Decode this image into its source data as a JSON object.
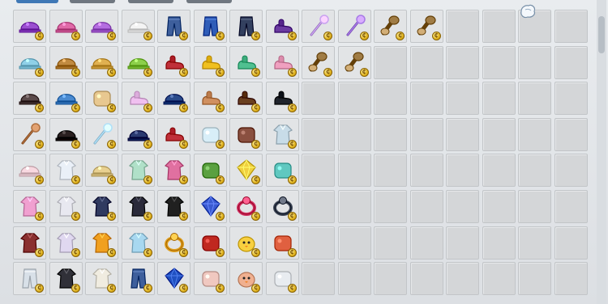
{
  "tabs": [
    {
      "label": "",
      "active": true
    },
    {
      "label": "",
      "active": false
    },
    {
      "label": "",
      "active": false
    },
    {
      "label": "",
      "active": false
    }
  ],
  "coin_label": "₵",
  "grid": {
    "columns": 16,
    "rows": 8,
    "items": [
      [
        "purple-bow-ribbon",
        "pink-headband",
        "purple-bow",
        "white-bonnet",
        "blue-jeans",
        "blue-shorts",
        "navy-pants",
        "purple-boots",
        "crystal-staff",
        "violet-wand",
        "twin-bone-club",
        "twin-bone-club",
        null,
        null,
        null,
        null
      ],
      [
        "bear-hood",
        "straw-hat",
        "ram-horns",
        "sprout-cap",
        "red-sandals",
        "yellow-shoes",
        "green-sneakers",
        "pink-boots",
        "twin-bone-club",
        "twin-bone-club",
        null,
        null,
        null,
        null,
        null,
        null
      ],
      [
        "panda-hood",
        "blue-beanie",
        "pearl-necklace",
        "fairy-wings-shoes",
        "blue-cap",
        "tan-boots",
        "brown-shoes",
        "black-shoes",
        null,
        null,
        null,
        null,
        null,
        null,
        null,
        null
      ],
      [
        "brown-whip",
        "black-hood",
        "ice-feather",
        "blue-hat",
        "red-sandals",
        "white-glove",
        "brown-mitten",
        "white-coat",
        null,
        null,
        null,
        null,
        null,
        null,
        null,
        null
      ],
      [
        "bunny-ears",
        "white-tank-top",
        "shell-hat",
        "mint-robe",
        "pink-flower-dress",
        "green-umbrella",
        "gold-star-pin",
        "teal-scarf",
        null,
        null,
        null,
        null,
        null,
        null,
        null,
        null
      ],
      [
        "pink-dress",
        "white-gown",
        "navy-dress",
        "black-cape",
        "black-robe",
        "star-lantern",
        "red-ring",
        "dark-ring",
        null,
        null,
        null,
        null,
        null,
        null,
        null,
        null
      ],
      [
        "pirate-coat",
        "white-gi",
        "yellow-duck-suit",
        "ghost-costume",
        "gold-ring",
        "red-armor",
        "yellow-chick",
        "candy-box",
        null,
        null,
        null,
        null,
        null,
        null,
        null,
        null
      ],
      [
        "white-overall",
        "black-vest",
        "white-tshirt",
        "blue-jeans",
        "blue-gem",
        "flower-pot",
        "chef-pig",
        "dove-wings",
        null,
        null,
        null,
        null,
        null,
        null,
        null,
        null
      ]
    ]
  },
  "item_colors": {
    "purple-bow-ribbon": "#9b4fd0",
    "pink-headband": "#e06aa8",
    "purple-bow": "#b46de0",
    "white-bonnet": "#f4f4f4",
    "blue-jeans": "#3e5f9c",
    "blue-shorts": "#2f5db8",
    "navy-pants": "#33405f",
    "purple-boots": "#6a3aa0",
    "crystal-staff": "#c9a2f0",
    "violet-wand": "#a77ae6",
    "twin-bone-club": "#a07c45",
    "bear-hood": "#8fd0e8",
    "straw-hat": "#c08a40",
    "ram-horns": "#e0b050",
    "sprout-cap": "#8ccf4a",
    "red-sandals": "#c0303a",
    "yellow-shoes": "#f0c020",
    "green-sneakers": "#50c090",
    "pink-boots": "#f0a0c0",
    "panda-hood": "#5a4a4a",
    "blue-beanie": "#4a8ad0",
    "pearl-necklace": "#e8c890",
    "fairy-wings-shoes": "#f0c0f0",
    "blue-cap": "#2a4a8a",
    "tan-boots": "#d09060",
    "brown-shoes": "#6a4020",
    "black-shoes": "#20242c",
    "brown-whip": "#b07040",
    "black-hood": "#2a2020",
    "ice-feather": "#b0e0f8",
    "blue-hat": "#2a3a70",
    "white-glove": "#d8eef8",
    "brown-mitten": "#8a5040",
    "white-coat": "#c8dce8",
    "bunny-ears": "#f8d8e0",
    "white-tank-top": "#eaf0f8",
    "shell-hat": "#e8d090",
    "mint-robe": "#b0e0c8",
    "pink-flower-dress": "#e070a0",
    "green-umbrella": "#5aa040",
    "gold-star-pin": "#f0d040",
    "teal-scarf": "#60c8c0",
    "pink-dress": "#f0a0d0",
    "white-gown": "#e8e8f0",
    "navy-dress": "#303a60",
    "black-cape": "#2a2a3a",
    "black-robe": "#202020",
    "star-lantern": "#3a5ad0",
    "red-ring": "#d03060",
    "dark-ring": "#404858",
    "pirate-coat": "#8a3030",
    "white-gi": "#e0d8f0",
    "yellow-duck-suit": "#f0a020",
    "ghost-costume": "#a8d8f0",
    "gold-ring": "#e0a020",
    "red-armor": "#c02820",
    "yellow-chick": "#f8d040",
    "candy-box": "#e06040",
    "white-overall": "#d8e0e8",
    "black-vest": "#303038",
    "white-tshirt": "#f0ece0",
    "blue-gem": "#2050c0",
    "flower-pot": "#f0c8c0",
    "chef-pig": "#f0b090",
    "dove-wings": "#e8ecf0"
  }
}
